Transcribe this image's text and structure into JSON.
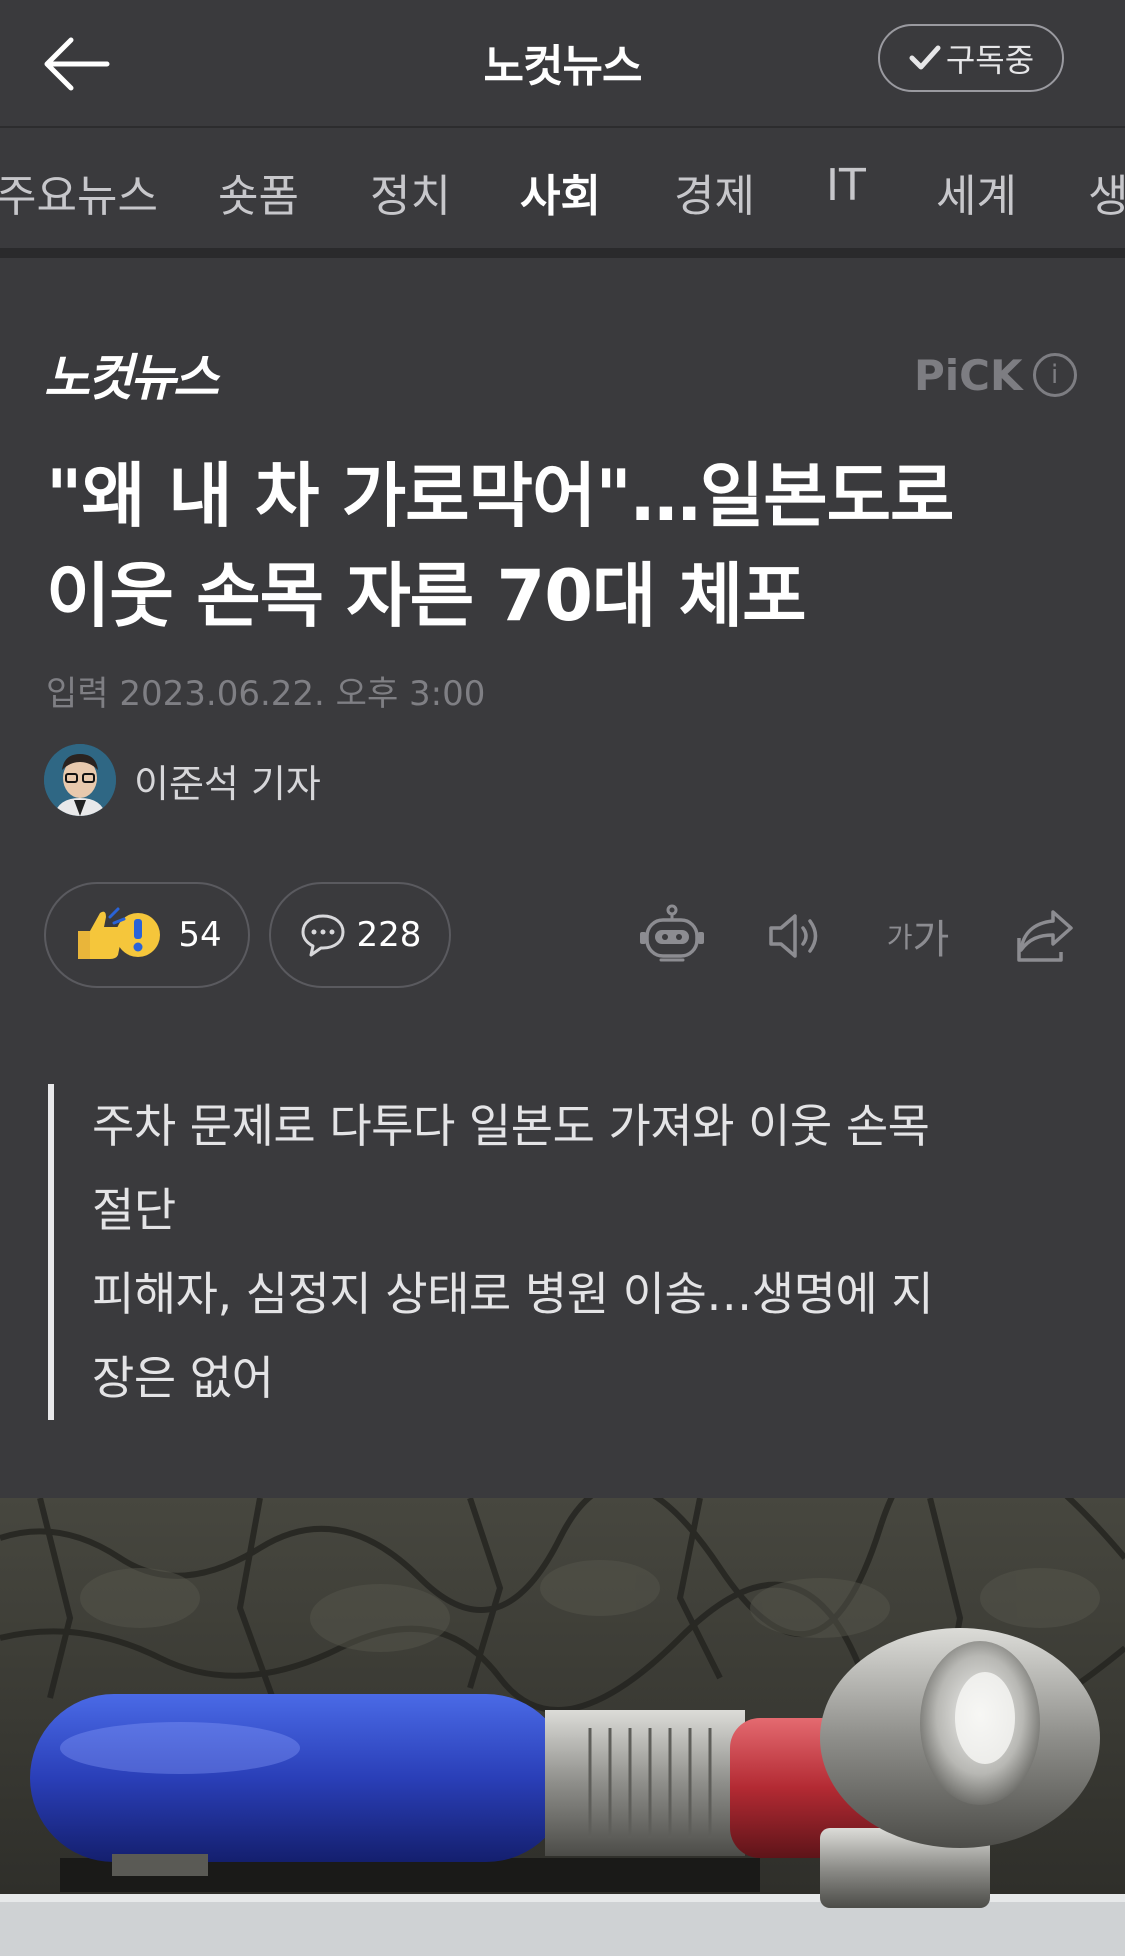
{
  "topbar": {
    "title": "노컷뉴스",
    "subscribe_label": "구독중"
  },
  "tabs": [
    {
      "label": "주요뉴스"
    },
    {
      "label": "숏폼"
    },
    {
      "label": "정치"
    },
    {
      "label": "사회"
    },
    {
      "label": "경제"
    },
    {
      "label": "IT"
    },
    {
      "label": "세계"
    },
    {
      "label": "생"
    }
  ],
  "active_tab": "사회",
  "article": {
    "press_logo_text": "노컷뉴스",
    "pick_label": "PiCK",
    "headline_line1": "\"왜 내 차 가로막어\"…일본도로",
    "headline_line2": "이웃 손목 자른 70대 체포",
    "date_label": "입력",
    "date_value": "2023.06.22. 오후 3:00",
    "reporter": "이준석 기자",
    "reaction_count": "54",
    "comment_count": "228",
    "font_tool_label_small": "가",
    "font_tool_label_large": "가",
    "summary_lines": [
      "주차 문제로 다투다 일본도 가져와 이웃 손목",
      "절단",
      "피해자, 심정지 상태로 병원 이송…생명에 지",
      "장은 없어"
    ]
  },
  "colors": {
    "background": "#3a3a3d",
    "text_primary": "#ffffff",
    "text_muted": "#7f7f84",
    "accent_blue": "#2f47c9",
    "accent_red": "#c8333c"
  }
}
